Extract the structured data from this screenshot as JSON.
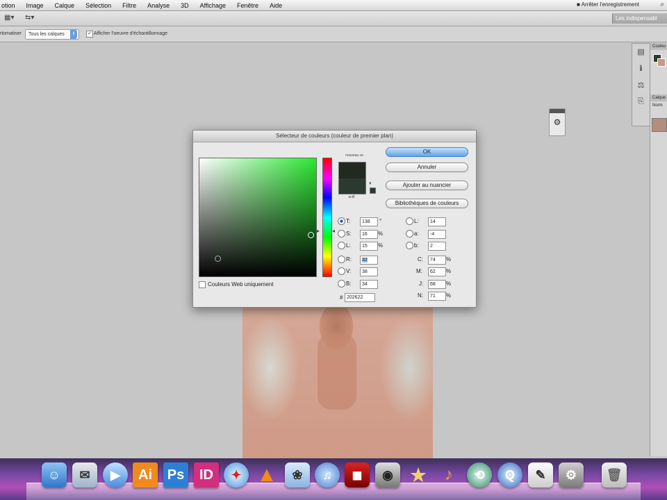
{
  "menubar": {
    "items": [
      "otion",
      "Image",
      "Calque",
      "Sélection",
      "Filtre",
      "Analyse",
      "3D",
      "Affichage",
      "Fenêtre",
      "Aide"
    ],
    "recording": "Arrêter l'enregistrement"
  },
  "appbar": {
    "workspace": "Les indispensabl"
  },
  "options": {
    "label": "rtomatiser",
    "select_value": "Tous les calques",
    "checkbox_label": "Afficher l'oeuvre d'échantillonnage"
  },
  "panels": {
    "color_header": "Couleu",
    "layers_header": "Calque",
    "layers_sub": "Norm"
  },
  "dialog": {
    "title": "Sélecteur de couleurs (couleur de premier plan)",
    "buttons": {
      "ok": "OK",
      "cancel": "Annuler",
      "add_swatch": "Ajouter au nuancier",
      "libraries": "Bibliothèques de couleurs"
    },
    "swatch_new_label": "nouveau ce",
    "swatch_current_label": "actif",
    "web_only": "Couleurs Web uniquement",
    "hsb": {
      "h": "138",
      "s": "16",
      "b": "15"
    },
    "rgb": {
      "r": "32",
      "g": "38",
      "b": "34"
    },
    "lab": {
      "l": "14",
      "a": "-4",
      "b": "2"
    },
    "cmyk": {
      "c": "74",
      "m": "62",
      "y": "68",
      "k": "71"
    },
    "hex": "202622",
    "labels": {
      "h": "T:",
      "s": "S:",
      "b": "L:",
      "r": "R:",
      "g": "V:",
      "bb": "B:",
      "l": "L:",
      "a": "a:",
      "lb": "b:",
      "c": "C:",
      "m": "M:",
      "y": "J:",
      "k": "N:",
      "deg": "°",
      "pct": "%",
      "hash": "#"
    },
    "colors": {
      "new": "#22291f",
      "current": "#2b3a30",
      "field_hue": "#29e82f"
    }
  },
  "dock": {
    "apps": [
      "Finder",
      "Mail",
      "iChat",
      "Illustrator",
      "Photoshop",
      "InDesign",
      "Safari",
      "VLC",
      "iPhoto",
      "iTunes",
      "Photo Booth",
      "Aperture",
      "iMovie",
      "GarageBand",
      "Time Machine",
      "QuickTime",
      "Aperçu",
      "Préférences Système",
      "Corbeille"
    ],
    "labels": {
      "ai": "Ai",
      "ps": "Ps",
      "id": "ID"
    }
  }
}
